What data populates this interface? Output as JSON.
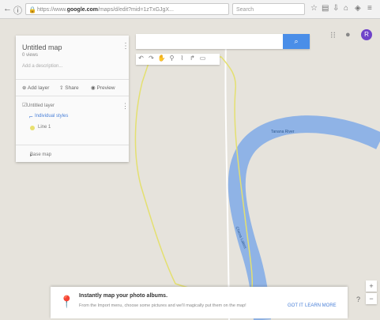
{
  "browser": {
    "address_prefix": "https://www.",
    "address_domain": "google.com",
    "address_rest": "/maps/d/edit?mid=1zTxGJgX...",
    "search_placeholder": "Search"
  },
  "panel": {
    "map_title": "Untitled map",
    "map_subtitle": "0 views",
    "map_description": "Add a description...",
    "add_layer": "Add layer",
    "share": "Share",
    "preview": "Preview",
    "layer_name": "Untitled layer",
    "individual_styles": "Individual styles",
    "item_label": "Line 1",
    "base_map": "Base map"
  },
  "river_labels": [
    "Tanana River",
    "Chena Lakes"
  ],
  "banner": {
    "heading": "Instantly map your photo albums.",
    "body": "From the Import menu, choose some pictures and we'll magically put them on the map!",
    "got_it": "GOT IT",
    "learn_more": "LEARN MORE"
  },
  "avatar_letter": "R",
  "colors": {
    "accent": "#4a8ee8",
    "river": "#8fb3e6",
    "avatar": "#6f43c9",
    "drawn_shape": "#e4e070"
  }
}
